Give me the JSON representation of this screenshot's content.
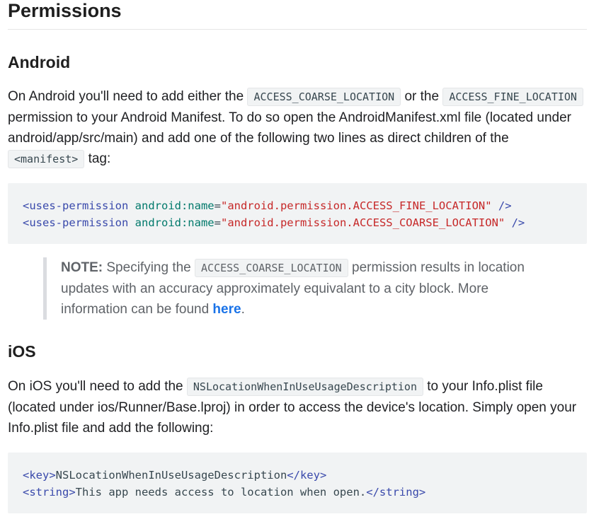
{
  "title": "Permissions",
  "android": {
    "heading": "Android",
    "para_1": "On Android you'll need to add either the ",
    "code_coarse": "ACCESS_COARSE_LOCATION",
    "para_2": " or the ",
    "code_fine": "ACCESS_FINE_LOCATION",
    "para_3": " permission to your Android Manifest. To do so open the AndroidManifest.xml file (located under android/app/src/main) and add one of the following two lines as direct children of the ",
    "code_manifest": "<manifest>",
    "para_4": " tag:",
    "code_lines": [
      {
        "tag_open": "<uses-permission",
        "attr": "android:name",
        "eq": "=",
        "value": "\"android.permission.ACCESS_FINE_LOCATION\"",
        "tag_close": " />"
      },
      {
        "tag_open": "<uses-permission",
        "attr": "android:name",
        "eq": "=",
        "value": "\"android.permission.ACCESS_COARSE_LOCATION\"",
        "tag_close": " />"
      }
    ]
  },
  "note": {
    "label": "NOTE:",
    "text_1": " Specifying the ",
    "code": "ACCESS_COARSE_LOCATION",
    "text_2": " permission results in location updates with an accuracy approximately equivalant to a city block. More information can be found ",
    "link": "here",
    "text_3": "."
  },
  "ios": {
    "heading": "iOS",
    "para_1": "On iOS you'll need to add the ",
    "code_key": "NSLocationWhenInUseUsageDescription",
    "para_2": " to your Info.plist file (located under ios/Runner/Base.lproj) in order to access the device's location. Simply open your Info.plist file and add the following:",
    "code_lines": [
      {
        "open": "<key>",
        "text": "NSLocationWhenInUseUsageDescription",
        "close": "</key>"
      },
      {
        "open": "<string>",
        "text": "This app needs access to location when open.",
        "close": "</string>"
      }
    ]
  },
  "colors": {
    "tag": "#3949ab",
    "attr": "#00796b",
    "string": "#c62828",
    "link": "#1a73e8",
    "code_bg": "#f1f3f4"
  }
}
